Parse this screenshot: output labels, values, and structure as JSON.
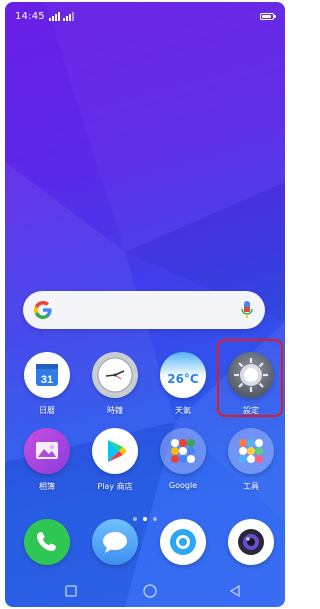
{
  "status_bar": {
    "time": "14:45",
    "battery_level": 0.85
  },
  "search": {
    "g_icon": "google-g-icon",
    "mic_icon": "mic-icon"
  },
  "apps_row1": [
    {
      "label": "日曆",
      "icon": "calendar-icon",
      "date": "31"
    },
    {
      "label": "時鐘",
      "icon": "clock-icon"
    },
    {
      "label": "天氣",
      "icon": "weather-icon",
      "temp": "26°C"
    },
    {
      "label": "設定",
      "icon": "gear-icon"
    }
  ],
  "apps_row2": [
    {
      "label": "相簿",
      "icon": "gallery-icon"
    },
    {
      "label": "Play 商店",
      "icon": "play-store-icon"
    },
    {
      "label": "Google",
      "icon": "google-folder-icon"
    },
    {
      "label": "工具",
      "icon": "tools-folder-icon"
    }
  ],
  "dock": [
    {
      "icon": "phone-icon"
    },
    {
      "icon": "messages-icon"
    },
    {
      "icon": "browser-icon"
    },
    {
      "icon": "camera-icon"
    }
  ],
  "pagination": {
    "pages": 3,
    "current": 2
  },
  "highlight_target": "設定",
  "colors": {
    "highlight_border": "#e01c22",
    "wallpaper_top": "#6a1fe6",
    "wallpaper_bottom": "#3168f4"
  }
}
